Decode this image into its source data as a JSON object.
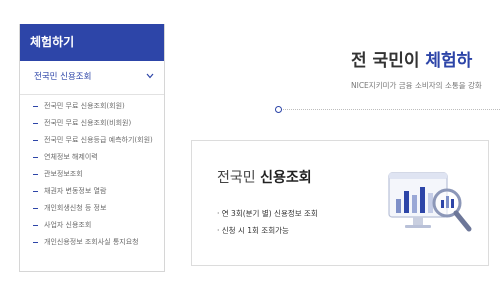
{
  "sidebar": {
    "header": "체험하기",
    "section": "전국민 신용조회",
    "items": [
      "전국민 무료 신용조회(회원)",
      "전국민 무료 신용조회(비회원)",
      "전국민 무료 신용등급 예측하기(회원)",
      "연체정보 해제이력",
      "관보정보조회",
      "채권자 변동정보 열람",
      "개인회생신청 등 정보",
      "사업자 신용조회",
      "개인신용정보 조회사실 통지요청"
    ]
  },
  "main": {
    "title_prefix": "전 국민이",
    "title_accent": "체험하",
    "subtitle": "NICE지키미가 금융 소비자의 소통을 강화",
    "card": {
      "title_prefix": "전국민",
      "title_accent": "신용조회",
      "bullets": [
        "· 연 3회(분기 별) 신용정보 조회",
        "· 신청 시 1회 조회가능"
      ],
      "illustration": "magnifier-chart-icon"
    }
  },
  "colors": {
    "brand": "#2d45a8"
  }
}
